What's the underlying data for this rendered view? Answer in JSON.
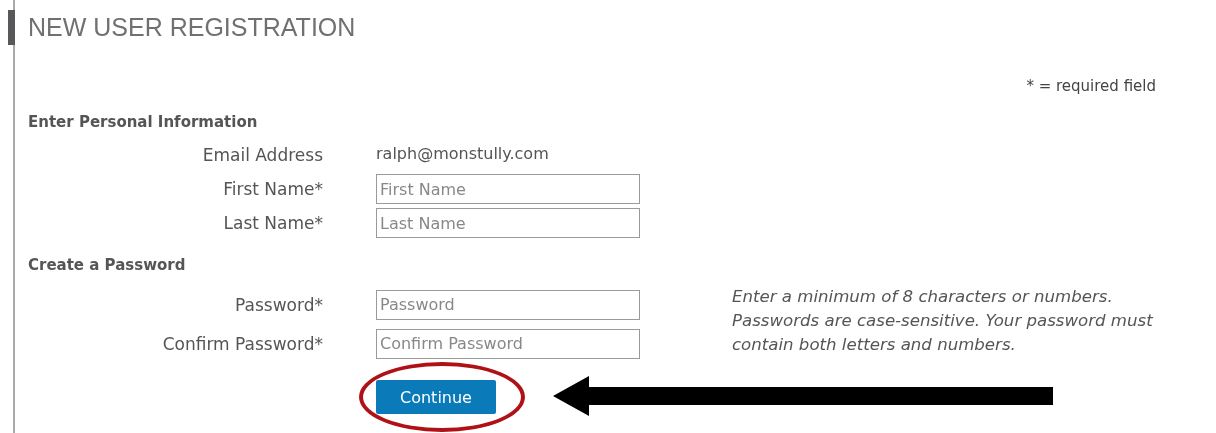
{
  "title": "NEW USER REGISTRATION",
  "required_note": "* = required field",
  "sections": [
    {
      "heading": "Enter Personal Information",
      "fields": [
        {
          "kind": "text",
          "label": "Email Address",
          "value": "ralph@monstully.com"
        },
        {
          "kind": "input",
          "label": "First Name*",
          "placeholder": "First Name"
        },
        {
          "kind": "input",
          "label": "Last Name*",
          "placeholder": "Last Name"
        }
      ]
    },
    {
      "heading": "Create a Password",
      "hint": "Enter a minimum of 8 characters or numbers. Passwords are case-sensitive. Your password must contain both letters and numbers.",
      "fields": [
        {
          "kind": "input",
          "label": "Password*",
          "placeholder": "Password"
        },
        {
          "kind": "input",
          "label": "Confirm Password*",
          "placeholder": "Confirm Password"
        }
      ]
    }
  ],
  "button": "Continue",
  "button_circled": true,
  "pointer_arrow": true
}
